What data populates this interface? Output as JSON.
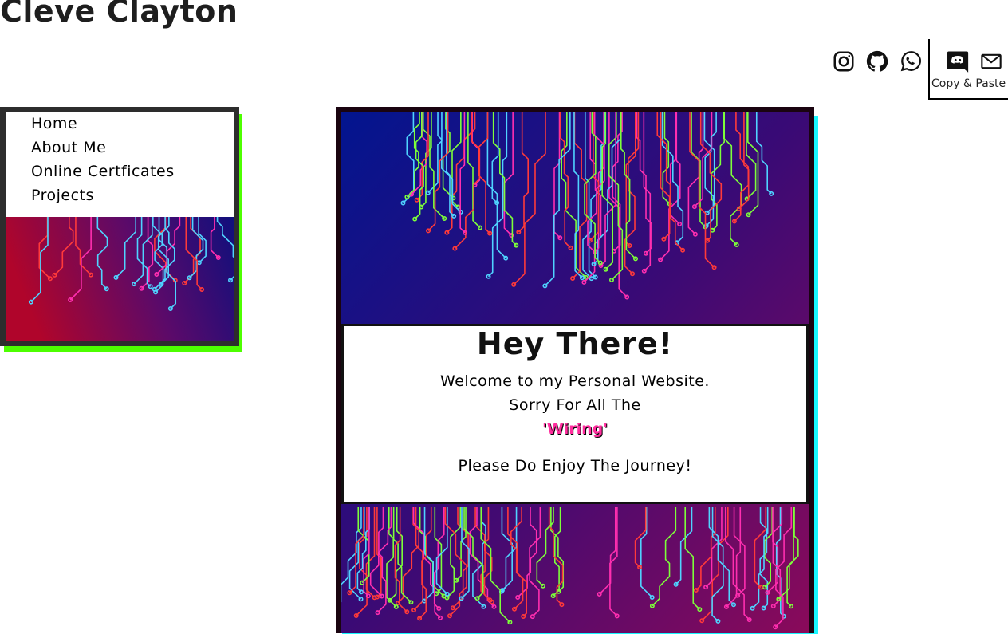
{
  "header": {
    "site_title": "Cleve Clayton"
  },
  "social": {
    "icons": [
      "instagram-icon",
      "github-icon",
      "whatsapp-icon",
      "discord-icon",
      "mail-icon"
    ],
    "copy_paste_label": "Copy & Paste"
  },
  "nav": {
    "items": [
      {
        "label": "Home"
      },
      {
        "label": "About Me"
      },
      {
        "label": "Online Certficates"
      },
      {
        "label": "Projects"
      }
    ]
  },
  "main": {
    "greeting": "Hey There!",
    "line1": "Welcome to my Personal Website.",
    "line2": "Sorry For All The",
    "wiring": "'Wiring'",
    "line3": "Please Do Enjoy The Journey!"
  },
  "colors": {
    "nav_shadow": "#4dff00",
    "main_shadow": "#19f7ff",
    "wiring_text": "#ff2e9e",
    "circuit_blue": "#4fd3ff",
    "circuit_green": "#7dff3a",
    "circuit_pink": "#ff2eb0",
    "circuit_red": "#ff3a3a"
  }
}
